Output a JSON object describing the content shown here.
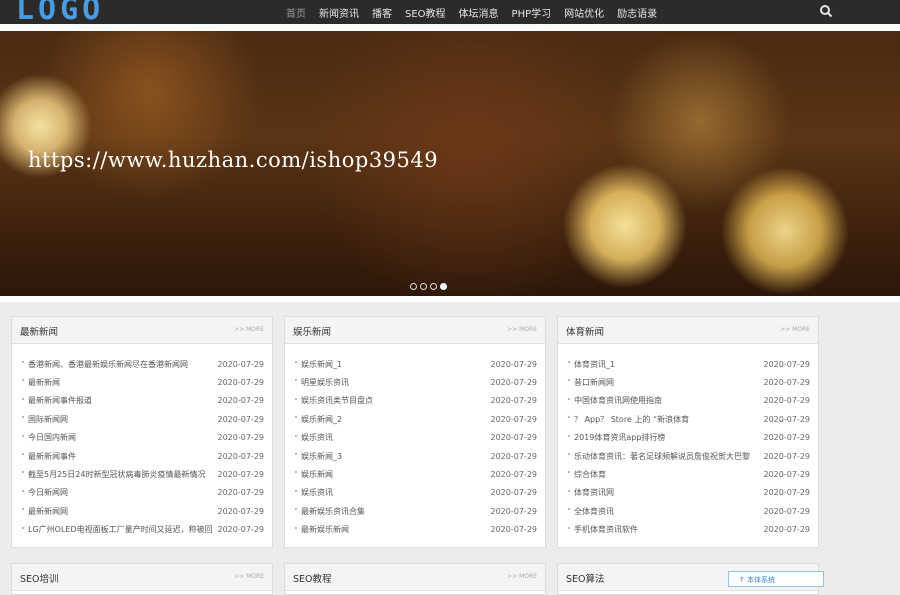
{
  "header": {
    "logo": "LOGO",
    "nav": [
      {
        "label": "首页",
        "active": true
      },
      {
        "label": "新闻资讯",
        "active": false
      },
      {
        "label": "播客",
        "active": false
      },
      {
        "label": "SEO教程",
        "active": false
      },
      {
        "label": "体坛消息",
        "active": false
      },
      {
        "label": "PHP学习",
        "active": false
      },
      {
        "label": "网站优化",
        "active": false
      },
      {
        "label": "励志语录",
        "active": false
      }
    ],
    "search_icon": "search-icon"
  },
  "banner": {
    "overlay_text": "https://www.huzhan.com/ishop39549",
    "slide_count": 4,
    "active_slide": 4
  },
  "panels": [
    {
      "title": "最新新闻",
      "more": ">> MORE",
      "items": [
        {
          "title": "香港新闻、香港最新娱乐新闻尽在香港新闻网",
          "date": "2020-07-29"
        },
        {
          "title": "最新新闻",
          "date": "2020-07-29"
        },
        {
          "title": "最新新闻事件报道",
          "date": "2020-07-29"
        },
        {
          "title": "国际新闻网",
          "date": "2020-07-29"
        },
        {
          "title": "今日国内新闻",
          "date": "2020-07-29"
        },
        {
          "title": "最新新闻事件",
          "date": "2020-07-29"
        },
        {
          "title": "截至5月25日24时新型冠状病毒肺炎疫情最新情况",
          "date": "2020-07-29"
        },
        {
          "title": "今日新闻网",
          "date": "2020-07-29"
        },
        {
          "title": "最新新闻网",
          "date": "2020-07-29"
        },
        {
          "title": "LG广州OLED电视面板工厂量产时间又延迟，称被回",
          "date": "2020-07-29"
        }
      ]
    },
    {
      "title": "娱乐新闻",
      "more": ">> MORE",
      "items": [
        {
          "title": "娱乐新闻_1",
          "date": "2020-07-29"
        },
        {
          "title": "明星娱乐资讯",
          "date": "2020-07-29"
        },
        {
          "title": "娱乐资讯类节目盘点",
          "date": "2020-07-29"
        },
        {
          "title": "娱乐新闻_2",
          "date": "2020-07-29"
        },
        {
          "title": "娱乐资讯",
          "date": "2020-07-29"
        },
        {
          "title": "娱乐新闻_3",
          "date": "2020-07-29"
        },
        {
          "title": "娱乐新闻",
          "date": "2020-07-29"
        },
        {
          "title": "娱乐资讯",
          "date": "2020-07-29"
        },
        {
          "title": "最新娱乐资讯合集",
          "date": "2020-07-29"
        },
        {
          "title": "最新娱乐新闻",
          "date": "2020-07-29"
        }
      ]
    },
    {
      "title": "体育新闻",
      "more": ">> MORE",
      "items": [
        {
          "title": "体育资讯_1",
          "date": "2020-07-29"
        },
        {
          "title": "昔口新闻网",
          "date": "2020-07-29"
        },
        {
          "title": "中国体育资讯网使用指南",
          "date": "2020-07-29"
        },
        {
          "title": "？ App？ Store 上的 “新浪体育",
          "date": "2020-07-29"
        },
        {
          "title": "2019体育资讯app排行榜",
          "date": "2020-07-29"
        },
        {
          "title": "乐动体育资讯：著名足球频解说员詹俊祝贺大巴黎",
          "date": "2020-07-29"
        },
        {
          "title": "综合体育",
          "date": "2020-07-29"
        },
        {
          "title": "体育资讯网",
          "date": "2020-07-29"
        },
        {
          "title": "全体育资讯",
          "date": "2020-07-29"
        },
        {
          "title": "手机体育资讯软件",
          "date": "2020-07-29"
        }
      ]
    }
  ],
  "bottom_panels": [
    {
      "title": "SEO培训",
      "more": ">> MORE"
    },
    {
      "title": "SEO教程",
      "more": ">> MORE"
    },
    {
      "title": "SEO算法",
      "more": ""
    }
  ],
  "login_hint": "↑ 本体系统"
}
